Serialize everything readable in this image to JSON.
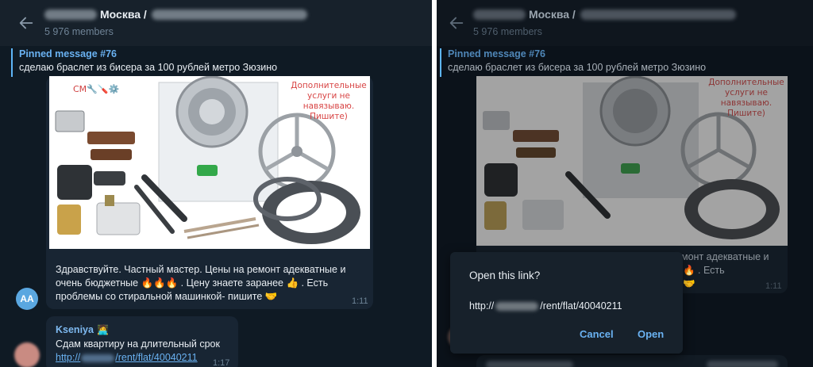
{
  "left": {
    "header": {
      "title_city": "Москва /",
      "members": "5 976 members"
    },
    "pinned": {
      "title": "Pinned message #76",
      "text": "сделаю браслет из бисера за 100 рублей метро Зюзино"
    },
    "photo_note": [
      "Дополнительные",
      "услуги не",
      "навязываю.",
      "Пишите)"
    ],
    "photo_top_text": "СМ🔧🪛⚙️",
    "message1": {
      "line1": "Здравствуйте. Частный мастер. Цены на ремонт адекватные и",
      "line2": "очень бюджетные 🔥🔥🔥 . Цену знаете заранее 👍 . Есть",
      "line3": "проблемы со стиральной машинкой- пишите 🤝",
      "time": "1:11"
    },
    "avatar_aa": "AA",
    "message2": {
      "sender": "Kseniya",
      "sender_emoji": "🧑‍💻",
      "text": "Сдам квартиру на длительный срок",
      "link_prefix": "http://",
      "link_suffix": "/rent/flat/40040211",
      "time": "1:17"
    }
  },
  "right": {
    "header": {
      "title_city": "Москва /",
      "members": "5 976 members"
    },
    "pinned": {
      "title": "Pinned message #76",
      "text": "сделаю браслет из бисера за 100 рублей метро Зюзино"
    },
    "photo_note": [
      "Дополнительные",
      "услуги не",
      "навязываю.",
      "Пишите)"
    ],
    "behind_text": {
      "line1": "монт адекватные и",
      "line2": "🔥 . Есть",
      "line3": "🤝"
    },
    "behind_time": "1:11",
    "dialog": {
      "title": "Open this link?",
      "url_prefix": "http://",
      "url_suffix": "/rent/flat/40040211",
      "cancel": "Cancel",
      "open": "Open"
    }
  }
}
